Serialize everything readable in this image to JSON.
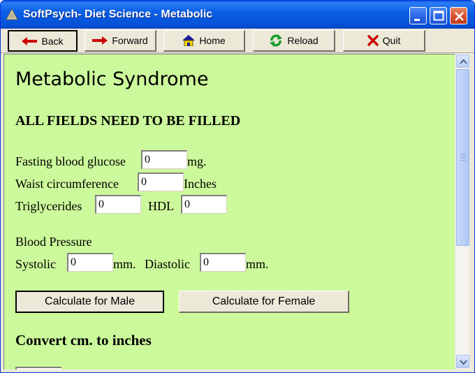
{
  "window": {
    "title": "SoftPsych-  Diet Science - Metabolic",
    "icons": {
      "app": "triangle-app-icon",
      "minimize": "minimize-icon",
      "maximize": "maximize-icon",
      "close": "close-icon"
    }
  },
  "toolbar": {
    "back": "Back",
    "forward": "Forward",
    "home": "Home",
    "reload": "Reload",
    "quit": "Quit"
  },
  "page": {
    "heading": "Metabolic Syndrome",
    "subheading": "ALL FIELDS NEED TO BE FILLED",
    "glucose": {
      "label": "Fasting blood glucose",
      "value": "0",
      "unit": "mg."
    },
    "waist": {
      "label": "Waist circumference",
      "value": "0",
      "unit": "Inches"
    },
    "triglycerides": {
      "label": "Triglycerides",
      "value": "0"
    },
    "hdl": {
      "label": "HDL",
      "value": "0"
    },
    "bp_label": "Blood Pressure",
    "systolic": {
      "label": "Systolic",
      "value": "0",
      "unit": "mm."
    },
    "diastolic": {
      "label": "Diastolic",
      "value": "0",
      "unit": "mm."
    },
    "calc_male": "Calculate for Male",
    "calc_female": "Calculate for Female",
    "convert_heading": "Convert cm. to inches"
  },
  "colors": {
    "content_bg": "#ccf99b",
    "titlebar": "#0a5fe6",
    "arrow_red": "#cc0000",
    "reload_green": "#1b9e2e"
  }
}
